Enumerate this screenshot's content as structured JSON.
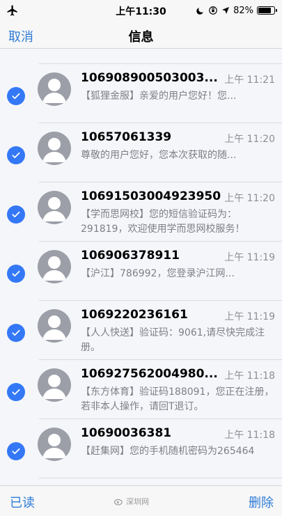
{
  "status_bar": {
    "time": "上午11:30",
    "battery": "82%",
    "battery_level": 0.82
  },
  "nav": {
    "cancel": "取消",
    "title": "信息"
  },
  "messages": [
    {
      "sender": "106908900503003...",
      "time": "上午 11:21",
      "preview": "【狐狸金服】亲爱的用户您好！您..."
    },
    {
      "sender": "10657061339",
      "time": "上午 11:20",
      "preview": "尊敬的用户您好，您本次获取的随..."
    },
    {
      "sender": "10691503004923950",
      "time": "上午 11:20",
      "preview": "【学而思网校】您的短信验证码为：291819，欢迎使用学而思网校服务！"
    },
    {
      "sender": "106906378911",
      "time": "上午 11:19",
      "preview": "【沪江】786992，您登录沪江网..."
    },
    {
      "sender": "1069220236161",
      "time": "上午 11:19",
      "preview": "【人人快送】验证码：9061,请尽快完成注册。"
    },
    {
      "sender": "106927562004980...",
      "time": "上午 11:18",
      "preview": "【东方体育】验证码188091，您正在注册，若非本人操作，请回T退订。"
    },
    {
      "sender": "10690036381",
      "time": "上午 11:18",
      "preview": "【赶集网】您的手机随机密码为265464"
    }
  ],
  "toolbar": {
    "mark_read": "已读",
    "delete": "删除",
    "watermark": "深圳网"
  },
  "colors": {
    "accent": "#2f7bd6",
    "check": "#3478f6",
    "avatar": "#9c9fa8"
  }
}
